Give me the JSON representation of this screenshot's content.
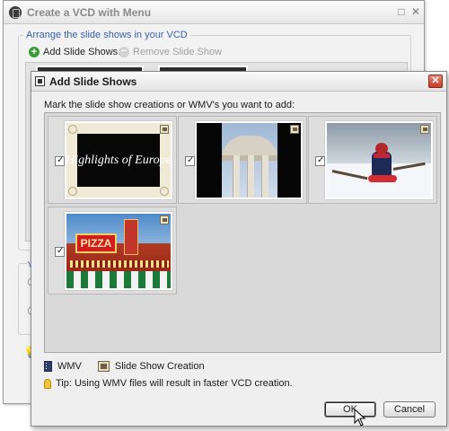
{
  "background_window": {
    "title": "Create a VCD with Menu",
    "group_label": "Arrange the slide shows in your VCD",
    "add_label": "Add Slide Shows...",
    "remove_label": "Remove Slide Show",
    "options_label_fragment": "Vi",
    "controls": [
      "□",
      "✕"
    ]
  },
  "dialog": {
    "title": "Add Slide Shows",
    "instruction": "Mark the slide show creations or WMV's you want to add:",
    "items": [
      {
        "name": "highlights-of-europe",
        "thumbnail_text": "Highlights of Europe",
        "checked": true,
        "type_icon": "slide-show-creation-icon"
      },
      {
        "name": "building-columns",
        "thumbnail_text": "",
        "checked": true,
        "type_icon": "slide-show-creation-icon"
      },
      {
        "name": "child-in-snow",
        "thumbnail_text": "",
        "checked": true,
        "type_icon": "slide-show-creation-icon"
      },
      {
        "name": "pizza-sign",
        "thumbnail_text": "PIZZA",
        "checked": true,
        "type_icon": "slide-show-creation-icon"
      }
    ],
    "legend": {
      "wmv_label": "WMV",
      "creation_label": "Slide Show Creation"
    },
    "tip": "Tip: Using WMV files will result in faster VCD creation.",
    "buttons": {
      "ok": "OK",
      "cancel": "Cancel"
    }
  },
  "colors": {
    "group_label_blue": "#3a62a8",
    "close_red": "#c33b25",
    "add_green": "#3b9b3b"
  }
}
